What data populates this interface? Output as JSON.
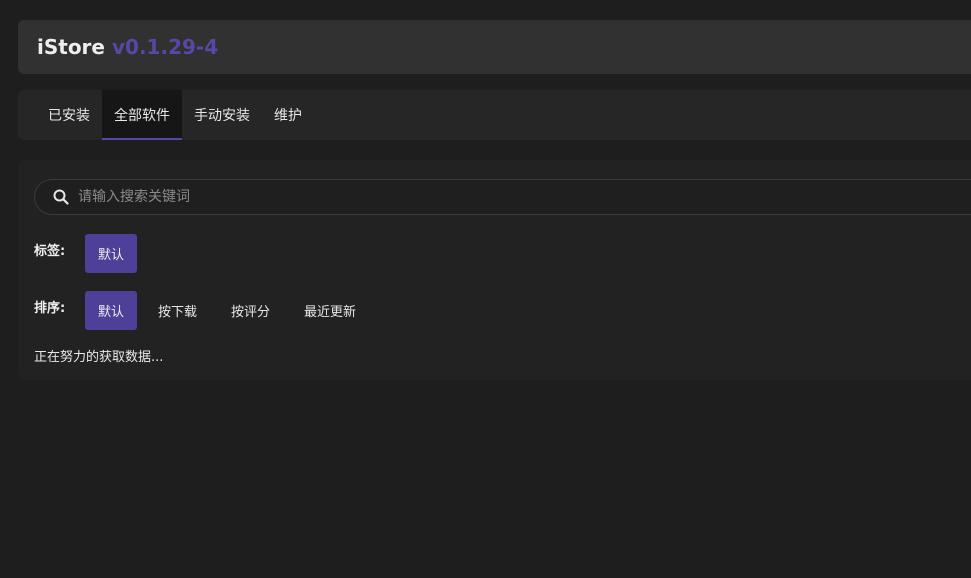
{
  "header": {
    "app_name": "iStore",
    "version": "v0.1.29-4",
    "version_color": "#5a46a6"
  },
  "tabs": [
    {
      "label": "已安装",
      "active": false
    },
    {
      "label": "全部软件",
      "active": true
    },
    {
      "label": "手动安装",
      "active": false
    },
    {
      "label": "维护",
      "active": false
    }
  ],
  "search": {
    "icon": "search-icon",
    "placeholder": "请输入搜索关键词",
    "value": ""
  },
  "tags": {
    "label": "标签:",
    "options": [
      {
        "label": "默认",
        "selected": true
      }
    ]
  },
  "sort": {
    "label": "排序:",
    "options": [
      {
        "label": "默认",
        "selected": true
      },
      {
        "label": "按下载",
        "selected": false
      },
      {
        "label": "按评分",
        "selected": false
      },
      {
        "label": "最近更新",
        "selected": false
      }
    ]
  },
  "status": {
    "loading_text": "正在努力的获取数据..."
  },
  "colors": {
    "accent": "#4e3f99",
    "background": "#1e1e1e"
  }
}
